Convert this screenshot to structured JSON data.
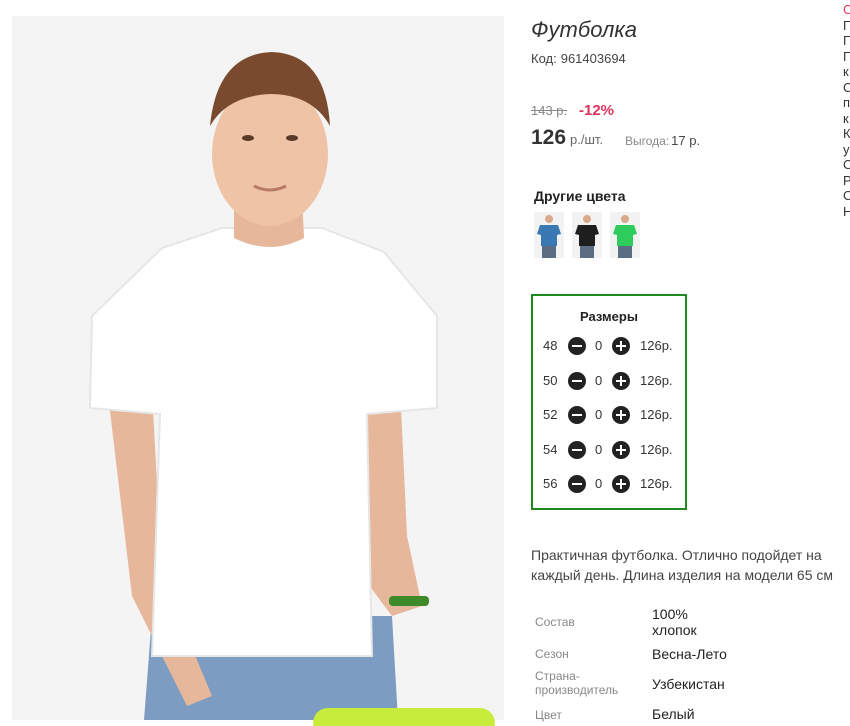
{
  "product": {
    "title": "Футболка",
    "code_label": "Код:",
    "code": "961403694"
  },
  "price": {
    "old": "143 р.",
    "discount": "-12%",
    "current": "126",
    "unit": "р./шт.",
    "benefit_label": "Выгода:",
    "benefit_value": "17 р."
  },
  "colors": {
    "title": "Другие цвета",
    "swatches": [
      {
        "name": "blue",
        "color": "#3a78b4"
      },
      {
        "name": "black",
        "color": "#1e1e1e"
      },
      {
        "name": "green",
        "color": "#2ecc5a"
      }
    ]
  },
  "sizes": {
    "title": "Размеры",
    "rows": [
      {
        "size": "48",
        "qty": "0",
        "price": "126р."
      },
      {
        "size": "50",
        "qty": "0",
        "price": "126р."
      },
      {
        "size": "52",
        "qty": "0",
        "price": "126р."
      },
      {
        "size": "54",
        "qty": "0",
        "price": "126р."
      },
      {
        "size": "56",
        "qty": "0",
        "price": "126р."
      }
    ]
  },
  "description": "Практичная футболка. Отлично подойдет на каждый день. Длина изделия на модели 65 см",
  "attributes": [
    {
      "label": "Состав",
      "value": "100%\nхлопок"
    },
    {
      "label": "Сезон",
      "value": "Весна-Лето"
    },
    {
      "label": "Страна-\nпроизводитель",
      "value": "Узбекистан"
    },
    {
      "label": "Цвет",
      "value": "Белый"
    }
  ],
  "side_letters": [
    "С",
    "П",
    "П",
    "П",
    "к",
    "С",
    "п",
    "к",
    "К",
    "у",
    "С",
    "Р",
    "С",
    "Н"
  ],
  "theme": {
    "accent_green": "#1e8a1e",
    "discount_red": "#e0335a",
    "cart_green": "#c8ec3c"
  }
}
